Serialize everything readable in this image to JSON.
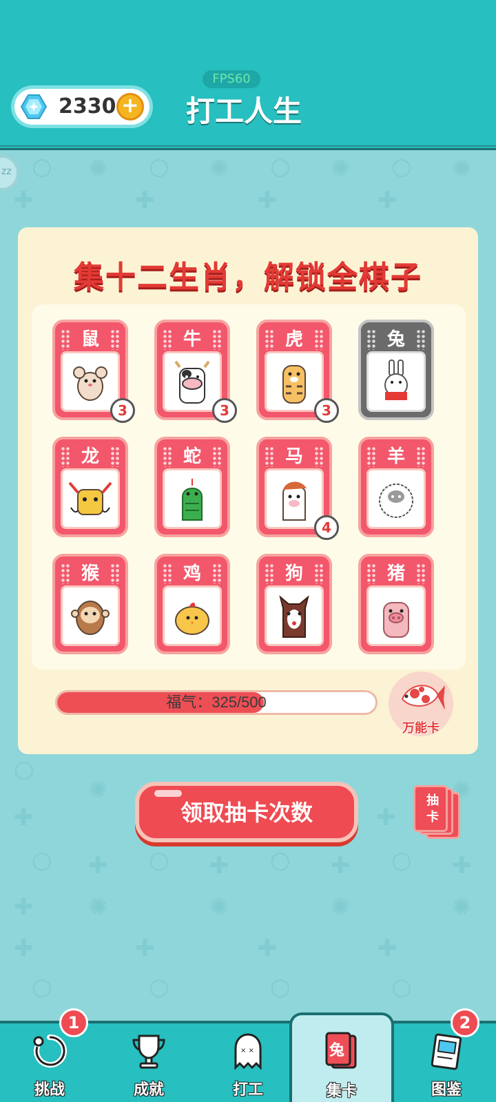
{
  "header": {
    "fps": "FPS60",
    "title": "打工人生",
    "gems": "2330",
    "add_icon": "plus-icon",
    "edge_label": "zz"
  },
  "panel": {
    "title": "集十二生肖，解锁全棋子",
    "cards": [
      {
        "name": "鼠",
        "icon": "rat-icon",
        "count": "3",
        "locked": false
      },
      {
        "name": "牛",
        "icon": "ox-icon",
        "count": "3",
        "locked": false
      },
      {
        "name": "虎",
        "icon": "tiger-icon",
        "count": "3",
        "locked": false
      },
      {
        "name": "兔",
        "icon": "rabbit-icon",
        "count": "",
        "locked": true
      },
      {
        "name": "龙",
        "icon": "dragon-icon",
        "count": "",
        "locked": false
      },
      {
        "name": "蛇",
        "icon": "snake-icon",
        "count": "",
        "locked": false
      },
      {
        "name": "马",
        "icon": "horse-icon",
        "count": "4",
        "locked": false
      },
      {
        "name": "羊",
        "icon": "sheep-icon",
        "count": "",
        "locked": false
      },
      {
        "name": "猴",
        "icon": "monkey-icon",
        "count": "",
        "locked": false
      },
      {
        "name": "鸡",
        "icon": "chicken-icon",
        "count": "",
        "locked": false
      },
      {
        "name": "狗",
        "icon": "dog-icon",
        "count": "",
        "locked": false
      },
      {
        "name": "猪",
        "icon": "pig-icon",
        "count": "",
        "locked": false
      }
    ],
    "progress": {
      "label": "福气：325/500",
      "value": 325,
      "max": 500
    },
    "wild_card_label": "万能卡"
  },
  "draw_button": {
    "label": "领取抽卡次数",
    "deck_label": "抽卡"
  },
  "nav": {
    "items": [
      {
        "label": "挑战",
        "icon": "challenge-icon",
        "badge": "1"
      },
      {
        "label": "成就",
        "icon": "trophy-icon",
        "badge": ""
      },
      {
        "label": "打工",
        "icon": "ghost-icon",
        "badge": ""
      },
      {
        "label": "集卡",
        "icon": "card-collect-icon",
        "badge": "",
        "card_text": "兔"
      },
      {
        "label": "图鉴",
        "icon": "handbook-icon",
        "badge": "2"
      }
    ]
  },
  "colors": {
    "header_bg": "#27bfbf",
    "page_bg": "#8fd6da",
    "card_red": "#f3576b",
    "accent_red": "#e33a35"
  }
}
